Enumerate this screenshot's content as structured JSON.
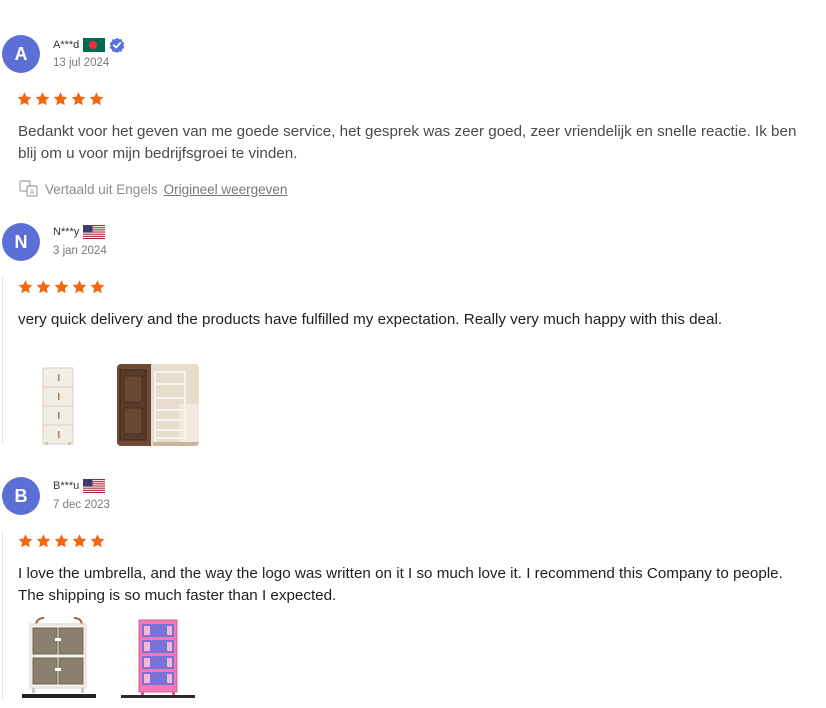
{
  "reviews": [
    {
      "avatar_letter": "A",
      "name": "A***d",
      "country_flag": "bangladesh-flag",
      "verified": true,
      "date": "13 jul 2024",
      "rating": 5,
      "text": "Bedankt voor het geven van me goede service, het gesprek was zeer goed, zeer vriendelijk en snelle reactie. Ik ben blij om u voor mijn bedrijfsgroei te vinden.",
      "translated_label": "Vertaald uit Engels",
      "show_original_label": "Origineel weergeven"
    },
    {
      "avatar_letter": "N",
      "name": "N***y",
      "country_flag": "usa-flag",
      "date": "3 jan 2024",
      "rating": 5,
      "text": "very quick delivery and the products have fulfilled my expectation. Really very much happy with this deal.",
      "photos": [
        "tall-white-storage-cabinet",
        "white-shoe-rack-in-room"
      ]
    },
    {
      "avatar_letter": "B",
      "name": "B***u",
      "country_flag": "usa-flag",
      "date": "7 dec 2023",
      "rating": 5,
      "text": "I love the umbrella, and the way the logo was written on it I so much love it. I recommend this Company to people. The shipping is so much faster than I expected.",
      "photos": [
        "white-wardrobe-cabinet-with-brown-doors",
        "pink-stacked-storage-cabinet"
      ]
    }
  ],
  "colors": {
    "avatar": "#5b6fd6",
    "star": "#f2670f",
    "verified": "#5a6fe0"
  }
}
